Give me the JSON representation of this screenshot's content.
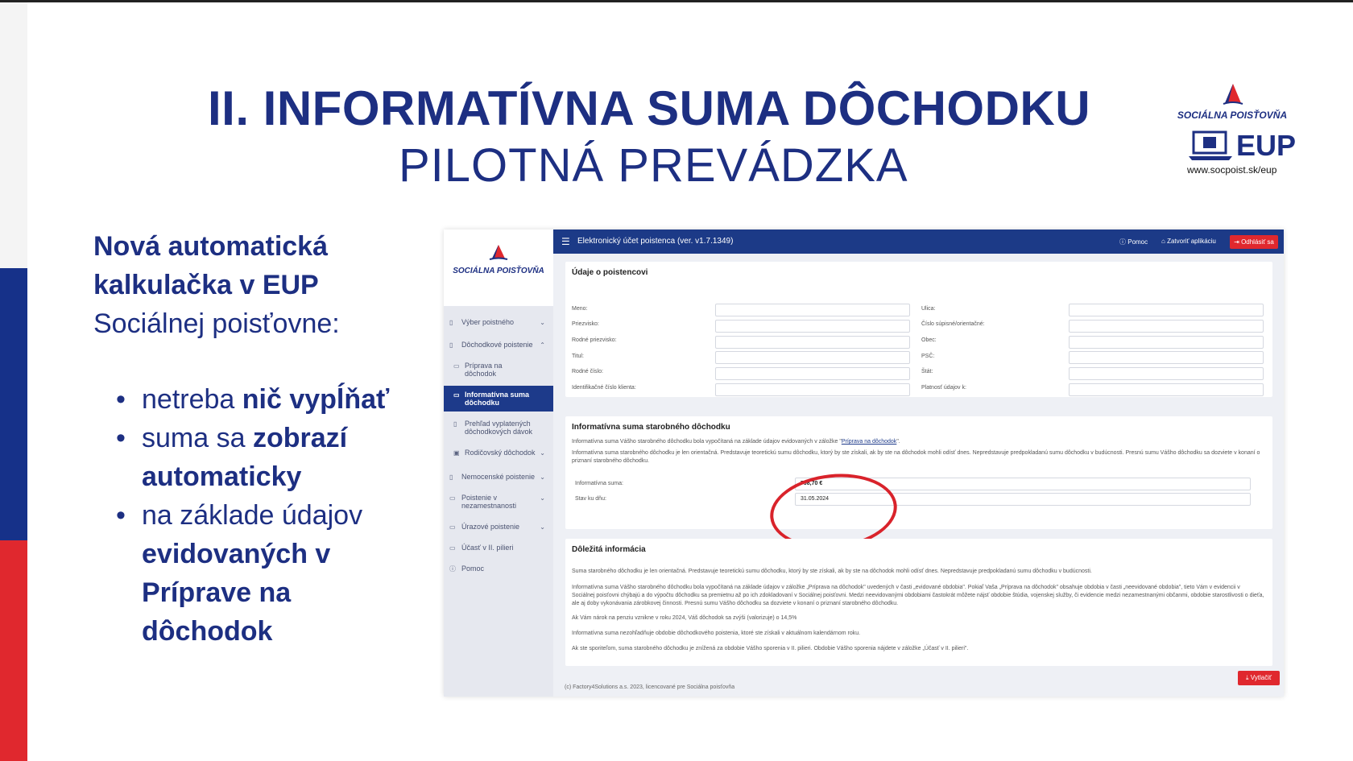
{
  "slide": {
    "title": "II. INFORMATÍVNA SUMA DÔCHODKU",
    "subtitle": "PILOTNÁ PREVÁDZKA",
    "logo": {
      "name": "SOCIÁLNA POISŤOVŇA",
      "product": "EUP",
      "url": "www.socpoist.sk/eup"
    },
    "lead": {
      "line1": "Nová automatická",
      "line2": "kalkulačka v EUP",
      "line3": "Sociálnej poisťovne:"
    },
    "bullets": [
      {
        "normal": "netreba ",
        "bold": "nič vypĺňať"
      },
      {
        "normal": "suma sa ",
        "bold": "zobrazí automaticky"
      },
      {
        "normal": "na základe údajov ",
        "bold": "evidovaných v Príprave na dôchodok"
      }
    ]
  },
  "app": {
    "brand": "SOCIÁLNA POISŤOVŇA",
    "header_title": "Elektronický účet poistenca (ver. v1.7.1349)",
    "header_help": "Pomoc",
    "header_close": "Zatvoriť aplikáciu",
    "header_logout": "Odhlásiť sa",
    "nav": [
      {
        "label": "Výber poistného"
      },
      {
        "label": "Dôchodkové poistenie"
      },
      {
        "label": "Príprava na dôchodok"
      },
      {
        "label": "Informatívna suma dôchodku"
      },
      {
        "label": "Prehľad vyplatených dôchodkových dávok"
      },
      {
        "label": "Rodičovský dôchodok"
      },
      {
        "label": "Nemocenské poistenie"
      },
      {
        "label": "Poistenie v nezamestnanosti"
      },
      {
        "label": "Úrazové poistenie"
      },
      {
        "label": "Účasť v II. pilieri"
      },
      {
        "label": "Pomoc"
      }
    ],
    "personal": {
      "title": "Údaje o poistencovi",
      "left_labels": [
        "Meno:",
        "Priezvisko:",
        "Rodné priezvisko:",
        "Titul:",
        "Rodné číslo:",
        "Identifikačné číslo klienta:"
      ],
      "right_labels": [
        "Ulica:",
        "Číslo súpisné/orientačné:",
        "Obec:",
        "PSČ:",
        "Štát:",
        "Platnosť údajov k:"
      ]
    },
    "info": {
      "title": "Informatívna suma starobného dôchodku",
      "line1": "Informatívna suma Vášho starobného dôchodku bola vypočítaná na základe údajov evidovaných v záložke \"",
      "line1_link": "Príprava na dôchodok",
      "line1_end": "\".",
      "line2": "Informatívna suma starobného dôchodku je len orientačná. Predstavuje teoretickú sumu dôchodku, ktorý by ste získali, ak by ste na dôchodok mohli odísť dnes. Nepredstavuje predpokladanú sumu dôchodku v budúcnosti. Presnú sumu Vášho dôchodku sa dozviete v konaní o priznaní starobného dôchodku.",
      "sum_label": "Informatívna suma:",
      "sum_value": "798,70 €",
      "date_label": "Stav ku dňu:",
      "date_value": "31.05.2024"
    },
    "important": {
      "title": "Dôležitá informácia",
      "p1": "Suma starobného dôchodku je len orientačná. Predstavuje teoretickú sumu dôchodku, ktorý by ste získali, ak by ste na dôchodok mohli odísť dnes. Nepredstavuje predpokladanú sumu dôchodku v budúcnosti.",
      "p2": "Informatívna suma Vášho starobného dôchodku bola vypočítaná na základe údajov v záložke „Príprava na dôchodok\" uvedených v časti „evidované obdobia\". Pokiaľ Vaša „Príprava na dôchodok\" obsahuje obdobia v časti „neevidované obdobia\", tieto Vám v evidencii v Sociálnej poisťovni chýbajú a do výpočtu dôchodku sa premietnu až po ich zdokladovaní v Sociálnej poisťovni. Medzi neevidovanými obdobiami častokrát môžete nájsť obdobie štúdia, vojenskej služby, či evidencie medzi nezamestnanými občanmi, obdobie starostlivosti o dieťa, ale aj doby vykonávania zárobkovej činnosti. Presnú sumu Vášho dôchodku sa dozviete v konaní o priznaní starobného dôchodku.",
      "p3": "Ak Vám nárok na penziu vznikne v roku 2024, Váš dôchodok sa zvýši (valorizuje) o 14,5%",
      "p4": "Informatívna suma nezohľadňuje obdobie dôchodkového poistenia, ktoré ste získali v aktuálnom kalendárnom roku.",
      "p5": "Ak ste sporiteľom, suma starobného dôchodku je znížená za obdobie Vášho sporenia v II. pilieri. Obdobie Vášho sporenia nájdete v záložke „Účasť v II. pilieri\"."
    },
    "download": "Vytlačiť",
    "footer": "(c) Factory4Solutions a.s. 2023, licencované pre Sociálna poisťovňa"
  }
}
